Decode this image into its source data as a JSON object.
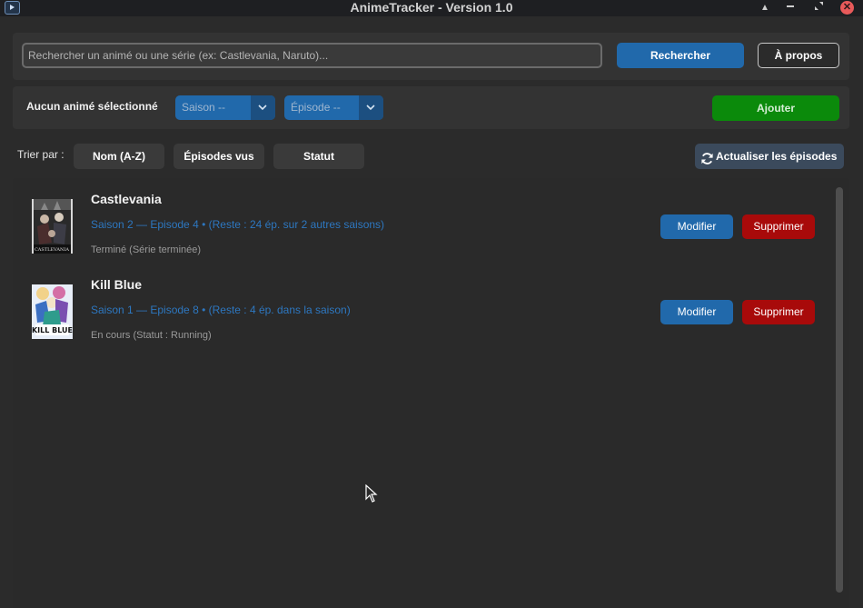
{
  "window": {
    "title": "AnimeTracker - Version 1.0"
  },
  "search": {
    "placeholder": "Rechercher un animé ou une série (ex: Castlevania, Naruto)...",
    "search_button": "Rechercher",
    "about_button": "À propos"
  },
  "selection": {
    "label": "Aucun animé sélectionné",
    "season_value": "Saison --",
    "episode_value": "Épisode --",
    "add_button": "Ajouter"
  },
  "sort": {
    "label": "Trier par :",
    "options": [
      "Nom (A-Z)",
      "Épisodes vus",
      "Statut"
    ],
    "refresh_button": "Actualiser les épisodes"
  },
  "anime_list": [
    {
      "title": "Castlevania",
      "progress": "Saison 2 — Episode 4 • (Reste : 24 ép. sur 2 autres saisons)",
      "status": "Terminé (Série terminée)",
      "edit_label": "Modifier",
      "delete_label": "Supprimer",
      "thumbnail_icon": "castlevania-poster"
    },
    {
      "title": "Kill Blue",
      "progress": "Saison 1 — Episode 8 • (Reste : 4 ép. dans la saison)",
      "status": "En cours (Statut : Running)",
      "edit_label": "Modifier",
      "delete_label": "Supprimer",
      "thumbnail_icon": "kill-blue-poster",
      "thumbnail_logo_text": "KILL BLUE"
    }
  ],
  "colors": {
    "primary_blue": "#2169ab",
    "add_green": "#0b8a0b",
    "delete_red": "#a80a0a",
    "progress_text": "#2d77c0"
  }
}
